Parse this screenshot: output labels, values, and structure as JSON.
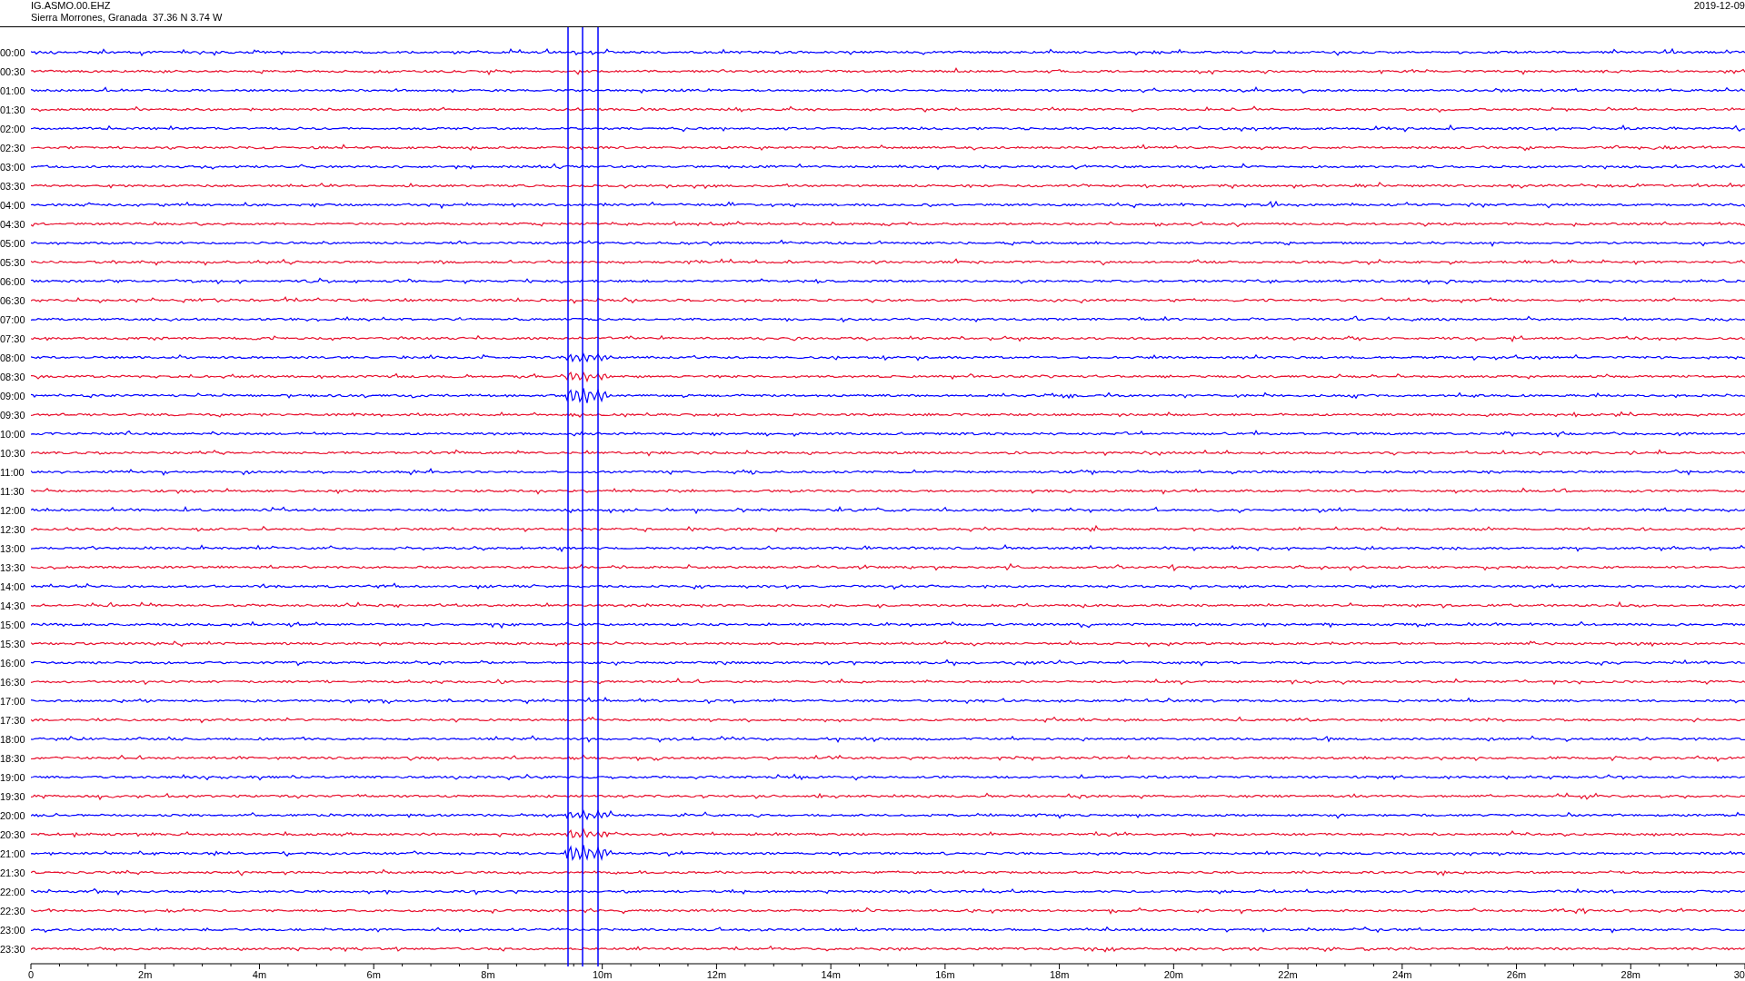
{
  "header": {
    "station": "IG.ASMO.00.EHZ",
    "location": "Sierra Morrones, Granada  37.36 N 3.74 W",
    "date": "2019-12-09"
  },
  "rows": [
    {
      "time": "00:00",
      "color": "#0000ff"
    },
    {
      "time": "00:30",
      "color": "#e8102e"
    },
    {
      "time": "01:00",
      "color": "#0000ff"
    },
    {
      "time": "01:30",
      "color": "#e8102e"
    },
    {
      "time": "02:00",
      "color": "#0000ff"
    },
    {
      "time": "02:30",
      "color": "#e8102e"
    },
    {
      "time": "03:00",
      "color": "#0000ff"
    },
    {
      "time": "03:30",
      "color": "#e8102e"
    },
    {
      "time": "04:00",
      "color": "#0000ff"
    },
    {
      "time": "04:30",
      "color": "#e8102e"
    },
    {
      "time": "05:00",
      "color": "#0000ff"
    },
    {
      "time": "05:30",
      "color": "#e8102e"
    },
    {
      "time": "06:00",
      "color": "#0000ff"
    },
    {
      "time": "06:30",
      "color": "#e8102e"
    },
    {
      "time": "07:00",
      "color": "#0000ff"
    },
    {
      "time": "07:30",
      "color": "#e8102e"
    },
    {
      "time": "08:00",
      "color": "#0000ff"
    },
    {
      "time": "08:30",
      "color": "#e8102e"
    },
    {
      "time": "09:00",
      "color": "#0000ff"
    },
    {
      "time": "09:30",
      "color": "#e8102e"
    },
    {
      "time": "10:00",
      "color": "#0000ff"
    },
    {
      "time": "10:30",
      "color": "#e8102e"
    },
    {
      "time": "11:00",
      "color": "#0000ff"
    },
    {
      "time": "11:30",
      "color": "#e8102e"
    },
    {
      "time": "12:00",
      "color": "#0000ff"
    },
    {
      "time": "12:30",
      "color": "#e8102e"
    },
    {
      "time": "13:00",
      "color": "#0000ff"
    },
    {
      "time": "13:30",
      "color": "#e8102e"
    },
    {
      "time": "14:00",
      "color": "#0000ff"
    },
    {
      "time": "14:30",
      "color": "#e8102e"
    },
    {
      "time": "15:00",
      "color": "#0000ff"
    },
    {
      "time": "15:30",
      "color": "#e8102e"
    },
    {
      "time": "16:00",
      "color": "#0000ff"
    },
    {
      "time": "16:30",
      "color": "#e8102e"
    },
    {
      "time": "17:00",
      "color": "#0000ff"
    },
    {
      "time": "17:30",
      "color": "#e8102e"
    },
    {
      "time": "18:00",
      "color": "#0000ff"
    },
    {
      "time": "18:30",
      "color": "#e8102e"
    },
    {
      "time": "19:00",
      "color": "#0000ff"
    },
    {
      "time": "19:30",
      "color": "#e8102e"
    },
    {
      "time": "20:00",
      "color": "#0000ff"
    },
    {
      "time": "20:30",
      "color": "#e8102e"
    },
    {
      "time": "21:00",
      "color": "#0000ff"
    },
    {
      "time": "21:30",
      "color": "#e8102e"
    },
    {
      "time": "22:00",
      "color": "#0000ff"
    },
    {
      "time": "22:30",
      "color": "#e8102e"
    },
    {
      "time": "23:00",
      "color": "#0000ff"
    },
    {
      "time": "23:30",
      "color": "#e8102e"
    }
  ],
  "axis": {
    "labels": [
      "0",
      "2m",
      "4m",
      "6m",
      "8m",
      "10m",
      "12m",
      "14m",
      "16m",
      "18m",
      "20m",
      "22m",
      "24m",
      "26m",
      "28m",
      "30"
    ]
  }
}
